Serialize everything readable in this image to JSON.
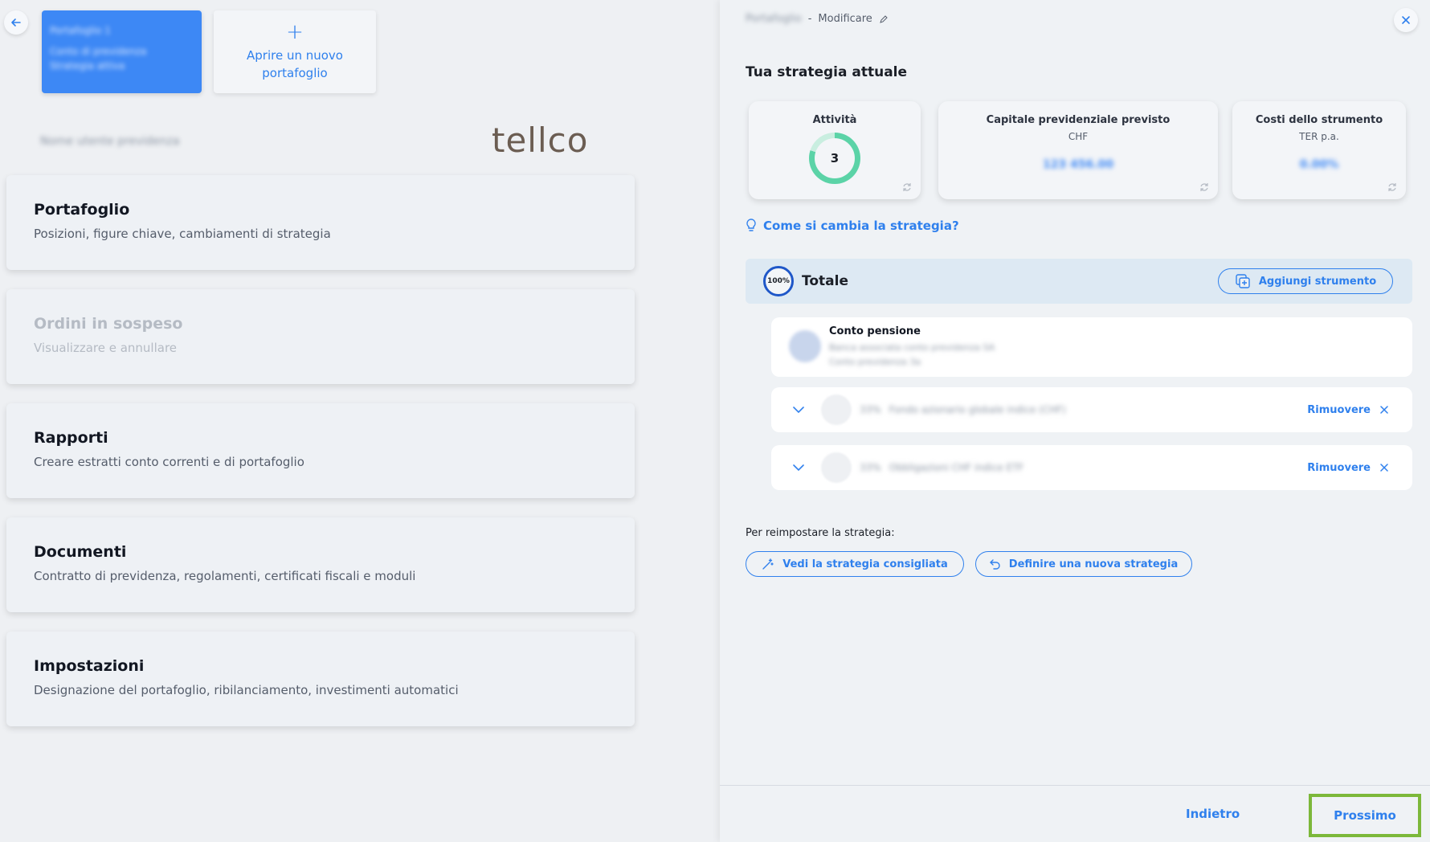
{
  "left": {
    "portfolio_card_lines": [
      "Portafoglio 1",
      "Conto di previdenza",
      "Strategia attiva"
    ],
    "new_portfolio_label": "Aprire un nuovo portafoglio",
    "account_name": "Nome utente previdenza",
    "logo_text": "tellco",
    "menu": [
      {
        "title": "Portafoglio",
        "subtitle": "Posizioni, figure chiave, cambiamenti di strategia"
      },
      {
        "title": "Ordini in sospeso",
        "subtitle": "Visualizzare e annullare"
      },
      {
        "title": "Rapporti",
        "subtitle": "Creare estratti conto correnti e di portafoglio"
      },
      {
        "title": "Documenti",
        "subtitle": "Contratto di previdenza, regolamenti, certificati fiscali e moduli"
      },
      {
        "title": "Impostazioni",
        "subtitle": "Designazione del portafoglio, ribilanciamento, investimenti automatici"
      }
    ]
  },
  "right": {
    "portfolio_name": "Portafoglio",
    "edit_label": "Modificare",
    "section_title": "Tua strategia attuale",
    "stats": {
      "activities": {
        "label": "Attività",
        "value": "3"
      },
      "capital": {
        "label": "Capitale previdenziale previsto",
        "sublabel": "CHF",
        "value": "123 456.00"
      },
      "costs": {
        "label": "Costi dello strumento",
        "sublabel": "TER p.a.",
        "value": "0.00%"
      }
    },
    "hint_label": "Come si cambia la strategia?",
    "total": {
      "percent": "100%",
      "label": "Totale",
      "add_label": "Aggiungi strumento"
    },
    "conto": {
      "name": "Conto pensione",
      "line1": "Banca associata conto previdenza SA",
      "line2": "Conto previdenza 3a"
    },
    "instruments": [
      {
        "pct": "33%",
        "name": "Fondo azionario globale indice (CHF)",
        "remove_label": "Rimuovere"
      },
      {
        "pct": "33%",
        "name": "Obbligazioni CHF indice ETF",
        "remove_label": "Rimuovere"
      }
    ],
    "reset_label": "Per reimpostare la strategia:",
    "recommended_label": "Vedi la strategia consigliata",
    "new_strategy_label": "Definire una nuova strategia",
    "footer": {
      "back_label": "Indietro",
      "next_label": "Prossimo"
    }
  },
  "colors": {
    "accent": "#2f80ed",
    "card_blue": "#3d88f5",
    "highlight": "#7cb83a",
    "donut": "#5bd3a7"
  },
  "icons": [
    "arrow-left-icon",
    "plus-icon",
    "close-icon",
    "pencil-icon",
    "refresh-icon",
    "lightbulb-icon",
    "add-copy-icon",
    "chevron-down-icon",
    "x-icon",
    "magic-wand-icon",
    "undo-icon"
  ]
}
